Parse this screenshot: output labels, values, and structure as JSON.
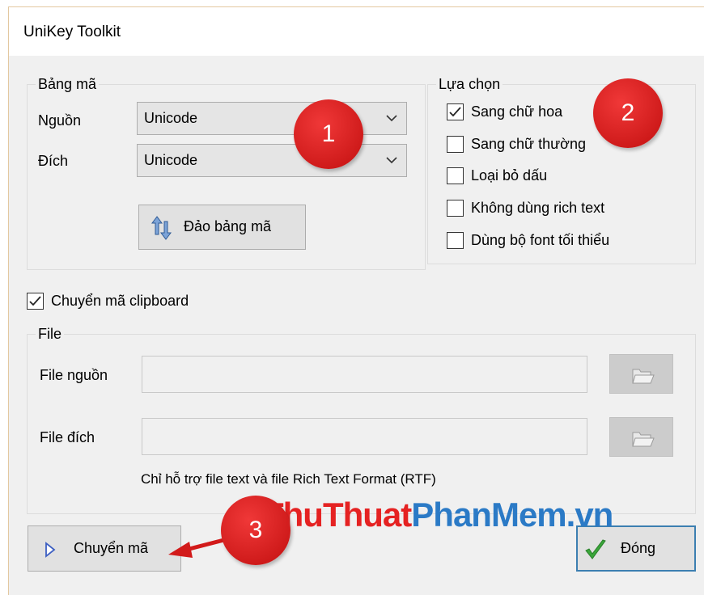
{
  "window": {
    "title": "UniKey Toolkit"
  },
  "encoding": {
    "legend": "Bảng mã",
    "source_label": "Nguồn",
    "source_value": "Unicode",
    "dest_label": "Đích",
    "dest_value": "Unicode",
    "swap_label": "Đảo bảng mã"
  },
  "options": {
    "legend": "Lựa chọn",
    "items": [
      {
        "label": "Sang chữ hoa",
        "checked": true
      },
      {
        "label": "Sang chữ thường",
        "checked": false
      },
      {
        "label": "Loại bỏ dấu",
        "checked": false
      },
      {
        "label": "Không dùng rich text",
        "checked": false
      },
      {
        "label": "Dùng bộ font tối thiểu",
        "checked": false
      }
    ]
  },
  "clipboard": {
    "label": "Chuyển mã clipboard",
    "checked": true
  },
  "file": {
    "legend": "File",
    "source_label": "File nguồn",
    "source_value": "",
    "dest_label": "File đích",
    "dest_value": "",
    "note": "Chỉ hỗ trợ file text và file Rich Text Format (RTF)"
  },
  "actions": {
    "convert_label": "Chuyển mã",
    "close_label": "Đóng"
  },
  "watermark": {
    "part1": "ThuThuat",
    "part2": "PhanMem",
    "part3": ".vn"
  },
  "annotations": {
    "badge1": "1",
    "badge2": "2",
    "badge3": "3"
  },
  "colors": {
    "badge_red": "#d21a1a",
    "watermark_red": "#e52222",
    "watermark_blue": "#2b7ac6",
    "close_border": "#3c7fb1",
    "check_green": "#3aa63a"
  }
}
